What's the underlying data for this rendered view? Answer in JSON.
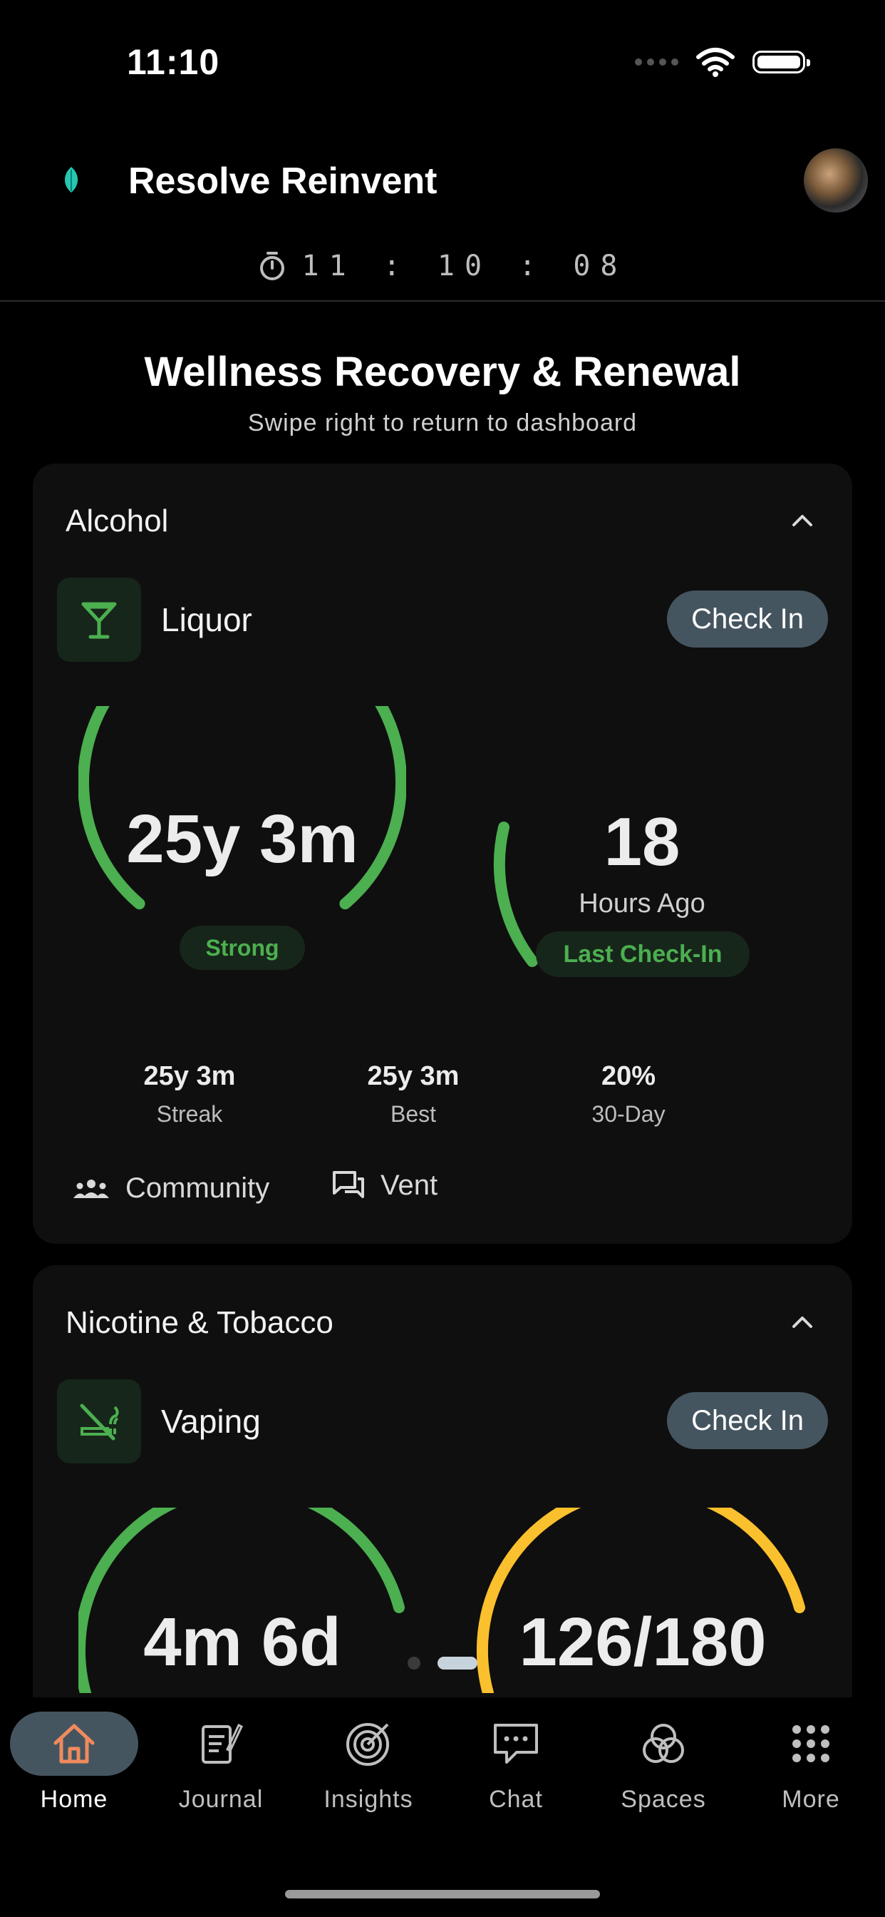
{
  "status_bar": {
    "time": "11:10"
  },
  "header": {
    "title": "Resolve Reinvent",
    "timer": "11 : 10 : 08"
  },
  "page": {
    "title": "Wellness Recovery & Renewal",
    "subtitle": "Swipe right to return to dashboard"
  },
  "cards": [
    {
      "category": "Alcohol",
      "item": "Liquor",
      "checkin_label": "Check In",
      "streak_display": "25y 3m",
      "strength_label": "Strong",
      "last_checkin_value": "18",
      "last_checkin_unit": "Hours Ago",
      "last_checkin_label": "Last Check-In",
      "stats": [
        {
          "value": "25y 3m",
          "label": "Streak"
        },
        {
          "value": "25y 3m",
          "label": "Best"
        },
        {
          "value": "20%",
          "label": "30-Day"
        }
      ],
      "links": {
        "community": "Community",
        "vent": "Vent"
      }
    },
    {
      "category": "Nicotine & Tobacco",
      "item": "Vaping",
      "checkin_label": "Check In",
      "streak_display": "4m 6d",
      "progress_display": "126/180"
    }
  ],
  "tabs": [
    {
      "label": "Home",
      "icon": "home-icon",
      "active": true
    },
    {
      "label": "Journal",
      "icon": "journal-icon"
    },
    {
      "label": "Insights",
      "icon": "insights-icon"
    },
    {
      "label": "Chat",
      "icon": "chat-icon"
    },
    {
      "label": "Spaces",
      "icon": "spaces-icon"
    },
    {
      "label": "More",
      "icon": "more-icon"
    }
  ],
  "colors": {
    "accent_green": "#4caf50",
    "accent_yellow": "#fbc02d",
    "button_slate": "#455560",
    "home_orange": "#f08a5d"
  }
}
